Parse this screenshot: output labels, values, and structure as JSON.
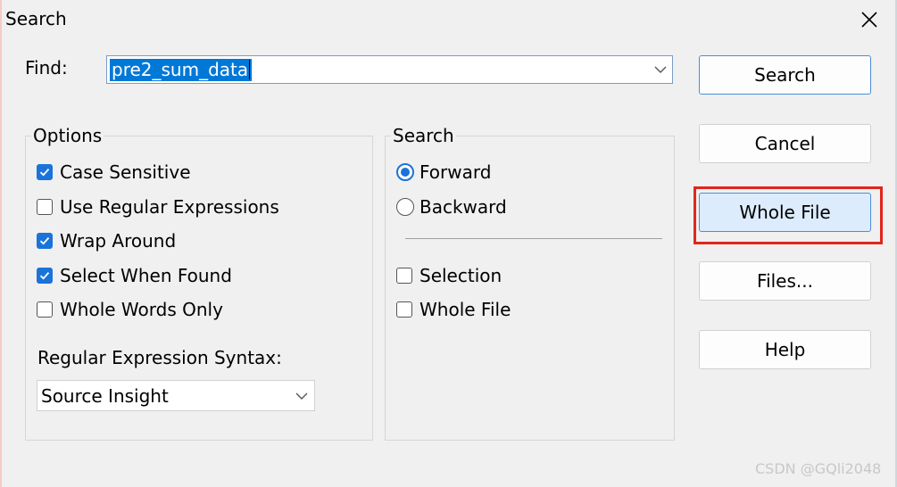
{
  "window": {
    "title": "Search"
  },
  "find": {
    "label": "Find:",
    "value": "pre2_sum_data"
  },
  "options": {
    "title": "Options",
    "items": [
      {
        "label": "Case Sensitive",
        "checked": true
      },
      {
        "label": "Use Regular Expressions",
        "checked": false
      },
      {
        "label": "Wrap Around",
        "checked": true
      },
      {
        "label": "Select When Found",
        "checked": true
      },
      {
        "label": "Whole Words Only",
        "checked": false
      }
    ],
    "syntax_label": "Regular Expression Syntax:",
    "syntax_value": "Source Insight"
  },
  "direction": {
    "title": "Search",
    "radios": [
      {
        "label": "Forward",
        "selected": true
      },
      {
        "label": "Backward",
        "selected": false
      }
    ],
    "scope": [
      {
        "label": "Selection",
        "checked": false
      },
      {
        "label": "Whole File",
        "checked": false
      }
    ]
  },
  "buttons": {
    "search": "Search",
    "cancel": "Cancel",
    "whole_file": "Whole File",
    "files": "Files...",
    "help": "Help"
  },
  "watermark": "CSDN @GQli2048",
  "colors": {
    "accent": "#1a73d9",
    "selection": "#0078d7",
    "annotation": "#e0261c",
    "hover_button": "#dcecfc"
  }
}
